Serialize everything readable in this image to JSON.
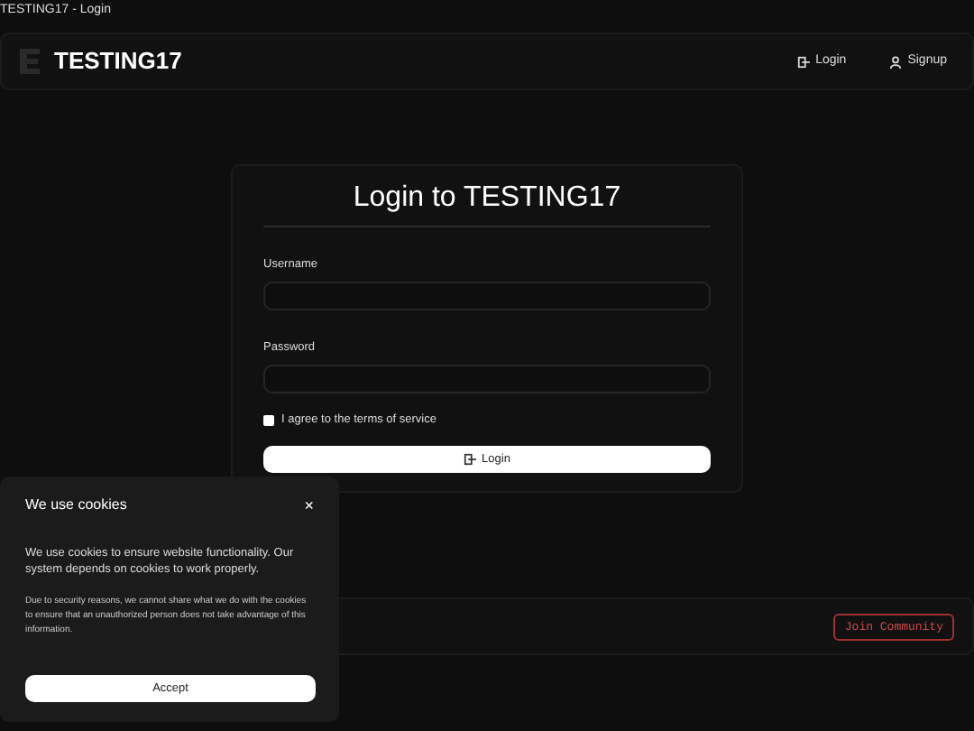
{
  "window": {
    "title": "TESTING17 - Login"
  },
  "navbar": {
    "brand": "TESTING17",
    "links": [
      {
        "label": "Login",
        "kind": "login"
      },
      {
        "label": "Signup",
        "kind": "signup"
      }
    ]
  },
  "login_card": {
    "title": "Login to TESTING17",
    "fields": [
      {
        "label": "Username"
      },
      {
        "label": "Password"
      }
    ],
    "terms": {
      "label": "I agree to the terms of service",
      "checked": false
    },
    "button": "Login"
  },
  "footer": {
    "button": "Join Community"
  },
  "cookie_popup": {
    "title": "We use cookies",
    "close": "×",
    "text": "We use cookies to ensure website functionality. Our system depends on cookies to work properly.",
    "note": "Due to security reasons, we cannot share what we do with the cookies to ensure that an unauthorized person does not take advantage of this information.",
    "button": "Accept"
  }
}
